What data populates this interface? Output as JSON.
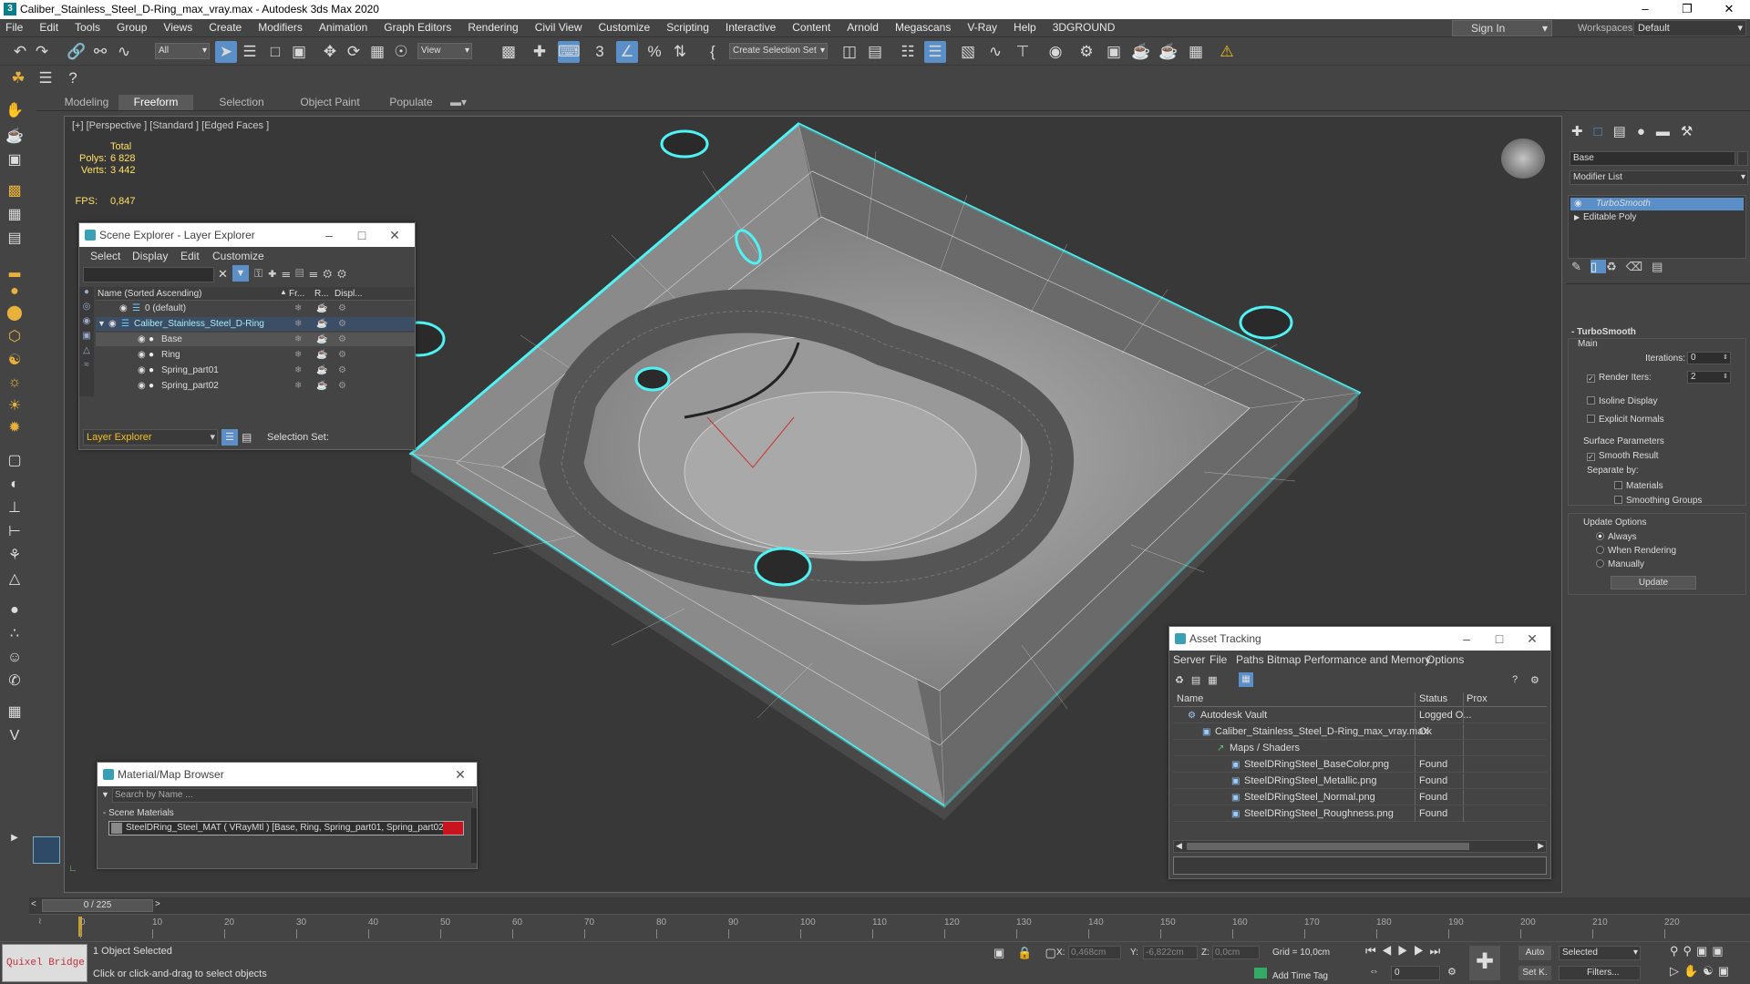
{
  "app": {
    "title": "Caliber_Stainless_Steel_D-Ring_max_vray.max - Autodesk 3ds Max 2020"
  },
  "menu": [
    "File",
    "Edit",
    "Tools",
    "Group",
    "Views",
    "Create",
    "Modifiers",
    "Animation",
    "Graph Editors",
    "Rendering",
    "Civil View",
    "Customize",
    "Scripting",
    "Interactive",
    "Content",
    "Arnold",
    "Megascans",
    "V-Ray",
    "Help",
    "3DGROUND"
  ],
  "account": {
    "sign_in": "Sign In",
    "workspaces_label": "Workspaces:",
    "workspace": "Default"
  },
  "toolbar": {
    "selection_filter": "All",
    "ref_coord": "View",
    "named_selection": "Create Selection Set"
  },
  "ribbon": {
    "tabs": [
      "Modeling",
      "Freeform",
      "Selection",
      "Object Paint",
      "Populate"
    ],
    "active": "Freeform"
  },
  "viewport": {
    "label": "[+] [Perspective ] [Standard ] [Edged Faces ]",
    "stats_total": "Total",
    "polys_label": "Polys:",
    "polys": "6 828",
    "verts_label": "Verts:",
    "verts": "3 442",
    "fps_label": "FPS:",
    "fps": "0,847"
  },
  "scene_explorer": {
    "title": "Scene Explorer - Layer Explorer",
    "menu": [
      "Select",
      "Display",
      "Edit",
      "Customize"
    ],
    "col_name": "Name (Sorted Ascending)",
    "col_fr": "Fr...",
    "col_r": "R...",
    "col_disp": "Displ...",
    "rows": [
      {
        "name": "0 (default)",
        "level": 1
      },
      {
        "name": "Caliber_Stainless_Steel_D-Ring",
        "level": 1
      },
      {
        "name": "Base",
        "level": 2
      },
      {
        "name": "Ring",
        "level": 2
      },
      {
        "name": "Spring_part01",
        "level": 2
      },
      {
        "name": "Spring_part02",
        "level": 2
      }
    ],
    "footer_select": "Layer Explorer",
    "selection_set_label": "Selection Set:"
  },
  "material_browser": {
    "title": "Material/Map Browser",
    "search_placeholder": "Search by Name ...",
    "group": "- Scene Materials",
    "material": "SteelDRing_Steel_MAT  ( VRayMtl )  [Base, Ring, Spring_part01, Spring_part02]"
  },
  "asset_tracking": {
    "title": "Asset Tracking",
    "menu": [
      "Server",
      "File",
      "Paths",
      "Bitmap Performance and Memory",
      "Options"
    ],
    "col_name": "Name",
    "col_status": "Status",
    "col_prox": "Prox",
    "rows": [
      {
        "name": "Autodesk Vault",
        "status": "Logged O...",
        "indent": 1
      },
      {
        "name": "Caliber_Stainless_Steel_D-Ring_max_vray.max",
        "status": "Ok",
        "indent": 2
      },
      {
        "name": "Maps / Shaders",
        "status": "",
        "indent": 3
      },
      {
        "name": "SteelDRingSteel_BaseColor.png",
        "status": "Found",
        "indent": 4
      },
      {
        "name": "SteelDRingSteel_Metallic.png",
        "status": "Found",
        "indent": 4
      },
      {
        "name": "SteelDRingSteel_Normal.png",
        "status": "Found",
        "indent": 4
      },
      {
        "name": "SteelDRingSteel_Roughness.png",
        "status": "Found",
        "indent": 4
      }
    ]
  },
  "command_panel": {
    "object_name": "Base",
    "modifier_list": "Modifier List",
    "stack": [
      "TurboSmooth",
      "Editable Poly"
    ],
    "rollout": "TurboSmooth",
    "main": "Main",
    "iterations_label": "Iterations:",
    "iterations": "0",
    "render_iters_label": "Render Iters:",
    "render_iters": "2",
    "isoline": "Isoline Display",
    "explicit_normals": "Explicit Normals",
    "surface_params": "Surface Parameters",
    "smooth_result": "Smooth Result",
    "separate_by": "Separate by:",
    "materials": "Materials",
    "smoothing_groups": "Smoothing Groups",
    "update_options": "Update Options",
    "always": "Always",
    "when_rendering": "When Rendering",
    "manually": "Manually",
    "update_btn": "Update"
  },
  "timeline": {
    "frame": "0 / 225",
    "ticks": [
      "0",
      "10",
      "20",
      "30",
      "40",
      "50",
      "60",
      "70",
      "80",
      "90",
      "100",
      "110",
      "120",
      "130",
      "140",
      "150",
      "160",
      "170",
      "180",
      "190",
      "200",
      "210",
      "220"
    ]
  },
  "status": {
    "quixel": "Quixel Bridge",
    "selected": "1 Object Selected",
    "prompt": "Click or click-and-drag to select objects",
    "x_label": "X:",
    "x": "0,468cm",
    "y_label": "Y:",
    "y": "-6,822cm",
    "z_label": "Z:",
    "z": "0,0cm",
    "grid": "Grid = 10,0cm",
    "add_time_tag": "Add Time Tag",
    "auto": "Auto",
    "set_key": "Set K.",
    "selected_dd": "Selected",
    "filters": "Filters...",
    "frame_spin": "0"
  }
}
